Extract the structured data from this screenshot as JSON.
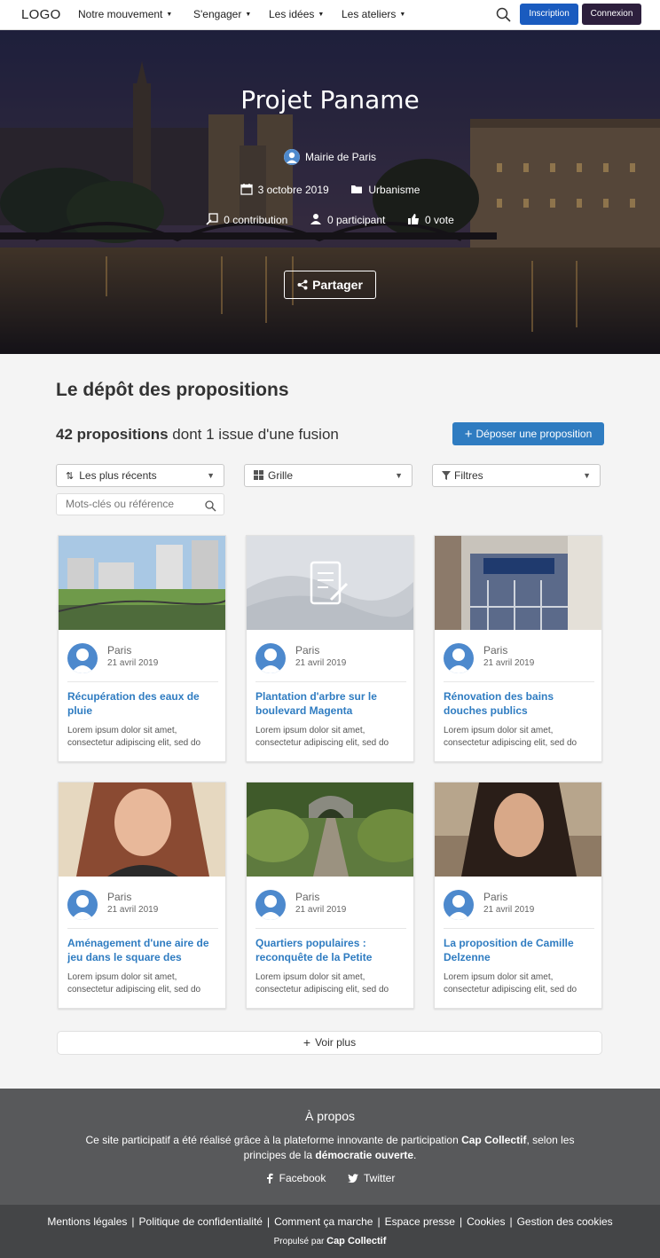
{
  "nav": {
    "logo": "LOGO",
    "items": [
      "Notre mouvement",
      "S'engager",
      "Les idées",
      "Les ateliers"
    ],
    "inscription": "Inscription",
    "connexion": "Connexion"
  },
  "hero": {
    "title": "Projet Paname",
    "author": "Mairie de Paris",
    "date": "3 octobre 2019",
    "category": "Urbanisme",
    "contributions": "0 contribution",
    "participants": "0 participant",
    "votes": "0 vote",
    "share": "Partager"
  },
  "main": {
    "section_title": "Le dépôt des propositions",
    "count_bold": "42 propositions",
    "count_rest": " dont 1 issue d'une fusion",
    "deposit_button": "Déposer une proposition",
    "sort_select": "Les plus récents",
    "view_select": "Grille",
    "filter_select": "Filtres",
    "search_placeholder": "Mots-clés ou référence",
    "see_more": "Voir plus"
  },
  "cards": [
    {
      "location": "Paris",
      "date": "21 avril 2019",
      "title": "Récupération des eaux de pluie",
      "excerpt": "Lorem ipsum dolor sit amet, consectetur adipiscing elit, sed do"
    },
    {
      "location": "Paris",
      "date": "21 avril 2019",
      "title": "Plantation d'arbre sur le boulevard Magenta",
      "excerpt": "Lorem ipsum dolor sit amet, consectetur adipiscing elit, sed do"
    },
    {
      "location": "Paris",
      "date": "21 avril 2019",
      "title": "Rénovation des bains douches publics",
      "excerpt": "Lorem ipsum dolor sit amet, consectetur adipiscing elit, sed do"
    },
    {
      "location": "Paris",
      "date": "21 avril 2019",
      "title": "Aménagement d'une aire de jeu dans le square des Batig…",
      "excerpt": "Lorem ipsum dolor sit amet, consectetur adipiscing elit, sed do"
    },
    {
      "location": "Paris",
      "date": "21 avril 2019",
      "title": "Quartiers populaires : reconquête de la Petite Cein…",
      "excerpt": "Lorem ipsum dolor sit amet, consectetur adipiscing elit, sed do"
    },
    {
      "location": "Paris",
      "date": "21 avril 2019",
      "title": "La proposition de Camille Delzenne",
      "excerpt": "Lorem ipsum dolor sit amet, consectetur adipiscing elit, sed do"
    }
  ],
  "footer": {
    "title": "À propos",
    "text_before": "Ce site participatif a été réalisé grâce à la plateforme innovante de participation ",
    "text_brand": "Cap Collectif",
    "text_middle": ", selon les principes de la ",
    "text_strong": "démocratie ouverte",
    "text_end": ".",
    "facebook": "Facebook",
    "twitter": "Twitter",
    "links": [
      "Mentions légales",
      "Politique de confidentialité",
      "Comment ça marche",
      "Espace presse",
      "Cookies",
      "Gestion des cookies"
    ],
    "powered_by": "Propulsé par",
    "powered_brand": "Cap Collectif"
  },
  "colors": {
    "primary_blue": "#2f7cc1",
    "inscription_blue": "#1a5bbf",
    "connexion_dark": "#2d1f3d",
    "footer_gray": "#58595b",
    "bottom_gray": "#444547"
  }
}
